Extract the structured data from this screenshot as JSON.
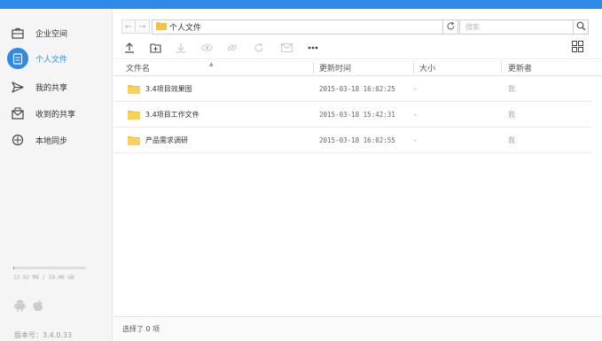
{
  "sidebar": {
    "items": [
      {
        "label": "企业空间",
        "icon": "briefcase-icon",
        "active": false
      },
      {
        "label": "个人文件",
        "icon": "document-icon",
        "active": true
      },
      {
        "label": "我的共享",
        "icon": "send-icon",
        "active": false
      },
      {
        "label": "收到的共享",
        "icon": "inbox-icon",
        "active": false
      },
      {
        "label": "本地同步",
        "icon": "sync-icon",
        "active": false
      }
    ],
    "storage": {
      "text": "12.92 MB / 10.00 GB",
      "used_fraction": 0.0013
    },
    "version": "版本号：3.4.0.33"
  },
  "toolbar": {
    "path": "个人文件",
    "search_placeholder": "搜索"
  },
  "table": {
    "columns": [
      "文件名",
      "更新时间",
      "大小",
      "更新者"
    ],
    "rows": [
      {
        "name": "3.4项目效果图",
        "time": "2015-03-18 16:02:25",
        "size": "-",
        "updater": "我"
      },
      {
        "name": "3.4项目工作文件",
        "time": "2015-03-18 15:42:31",
        "size": "-",
        "updater": "我"
      },
      {
        "name": "产品需求调研",
        "time": "2015-03-18 16:02:55",
        "size": "-",
        "updater": "我"
      }
    ]
  },
  "status": {
    "selected": "选择了 0 项"
  },
  "colors": {
    "accent": "#2e8ae6",
    "folder": "#f5c342"
  }
}
